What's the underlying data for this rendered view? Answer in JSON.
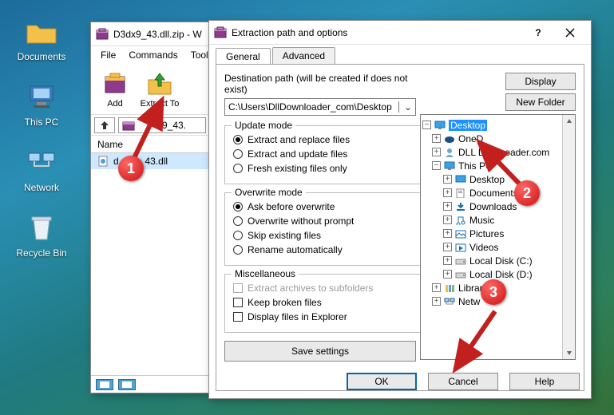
{
  "desktop": {
    "icons": [
      {
        "id": "documents",
        "label": "Documents"
      },
      {
        "id": "thispc",
        "label": "This PC"
      },
      {
        "id": "network",
        "label": "Network"
      },
      {
        "id": "recycle",
        "label": "Recycle Bin"
      }
    ]
  },
  "winrar": {
    "title": "D3dx9_43.dll.zip - W",
    "menu": [
      "File",
      "Commands",
      "Tools"
    ],
    "toolbar": [
      {
        "id": "add",
        "label": "Add"
      },
      {
        "id": "extract",
        "label": "Extract To"
      }
    ],
    "path_file": "x9_43.",
    "columns": [
      "Name"
    ],
    "file": {
      "name": "43.dll",
      "name_prefix": "d"
    }
  },
  "dialog": {
    "title": "Extraction path and options",
    "tabs": {
      "general": "General",
      "advanced": "Advanced"
    },
    "dest_label": "Destination path (will be created if does not exist)",
    "dest_value": "C:\\Users\\DllDownloader_com\\Desktop",
    "btn_display": "Display",
    "btn_newfolder": "New Folder",
    "update": {
      "legend": "Update mode",
      "r1": "Extract and replace files",
      "r2": "Extract and update files",
      "r3": "Fresh existing files only"
    },
    "overwrite": {
      "legend": "Overwrite mode",
      "r1": "Ask before overwrite",
      "r2": "Overwrite without prompt",
      "r3": "Skip existing files",
      "r4": "Rename automatically"
    },
    "misc": {
      "legend": "Miscellaneous",
      "c1": "Extract archives to subfolders",
      "c2": "Keep broken files",
      "c3": "Display files in Explorer"
    },
    "save_settings": "Save settings",
    "bottom": {
      "ok": "OK",
      "cancel": "Cancel",
      "help": "Help"
    },
    "tree": {
      "desktop": "Desktop",
      "onedrive": "OneD",
      "dlldown": "DLL D",
      "dlldown_suffix": "oader.com",
      "thispc": "This PC",
      "tp_desktop": "Desktop",
      "documents": "Documents",
      "downloads": "Downloads",
      "music": "Music",
      "pictures": "Pictures",
      "videos": "Videos",
      "local_c": "Local Disk (C:)",
      "local_d": "Local Disk (D:)",
      "libraries": "Libraries",
      "network": "Netw"
    }
  },
  "markers": {
    "m1": "1",
    "m2": "2",
    "m3": "3"
  }
}
